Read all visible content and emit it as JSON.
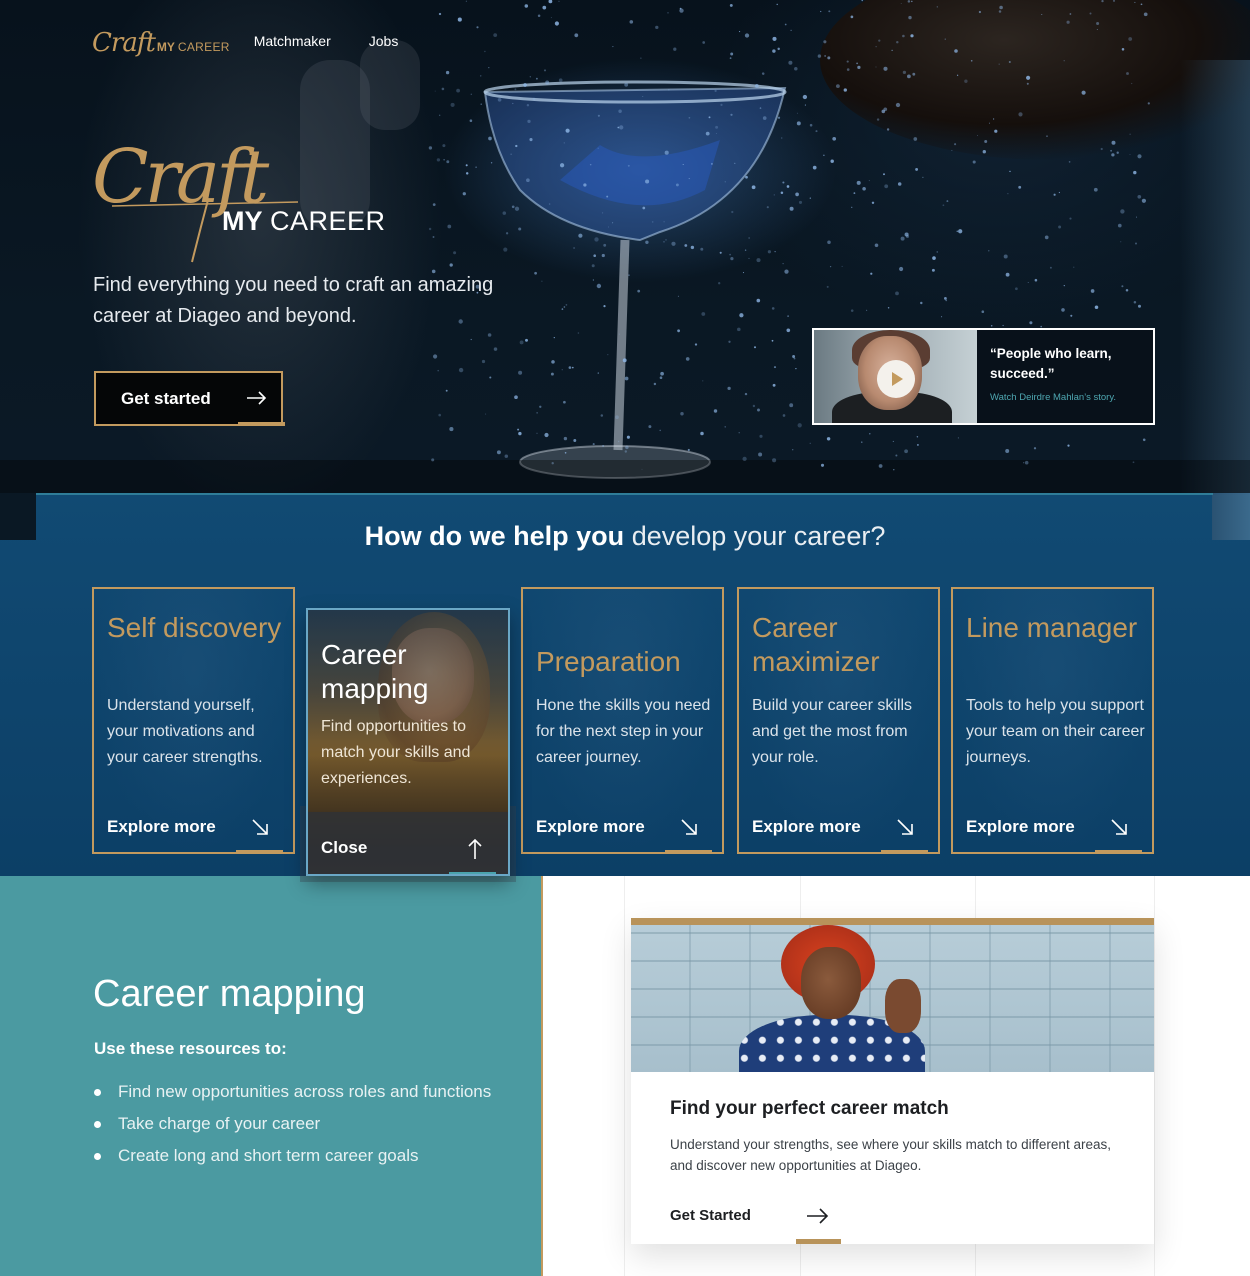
{
  "nav": {
    "logo_script": "Craft",
    "logo_my": "MY",
    "logo_career": "CAREER",
    "links": [
      "Matchmaker",
      "Jobs"
    ]
  },
  "hero": {
    "logo_script": "Craft",
    "logo_my": "MY",
    "logo_career": "CAREER",
    "tagline": "Find everything you need to craft an amazing career at Diageo and beyond.",
    "cta_label": "Get started",
    "cta_icon": "arrow-right-icon",
    "video": {
      "quote": "“People who learn, succeed.”",
      "link": "Watch Deirdre Mahlan’s story.",
      "play_icon": "play-icon"
    }
  },
  "help": {
    "title_bold": "How do we help you",
    "title_light": "develop your career?",
    "cards": [
      {
        "title": "Self discovery",
        "desc": "Understand yourself, your motivations and your career strengths.",
        "cta": "Explore more"
      },
      {
        "title": "Career mapping",
        "desc": "Find opportunities to match your skills and experiences.",
        "cta": "Close",
        "active": true
      },
      {
        "title": "Preparation",
        "desc": "Hone the skills you need for the next step in your career journey.",
        "cta": "Explore more"
      },
      {
        "title": "Career maximizer",
        "desc": "Build your career skills and get the most from your role.",
        "cta": "Explore more"
      },
      {
        "title": "Line manager",
        "desc": "Tools to help you support your team on their career journeys.",
        "cta": "Explore more"
      }
    ]
  },
  "mapping": {
    "title": "Career mapping",
    "subtitle": "Use these resources to:",
    "items": [
      "Find new opportunities across roles and functions",
      "Take charge of your career",
      "Create long and short term career goals"
    ]
  },
  "match": {
    "title": "Find your perfect career match",
    "desc": "Understand your strengths, see where your skills match to different areas, and discover new opportunities at Diageo.",
    "cta": "Get Started"
  },
  "colors": {
    "gold": "#c39a5e",
    "navy": "#0c3f66",
    "teal": "#4b9aa1",
    "accent_teal": "#4ea7b1"
  }
}
